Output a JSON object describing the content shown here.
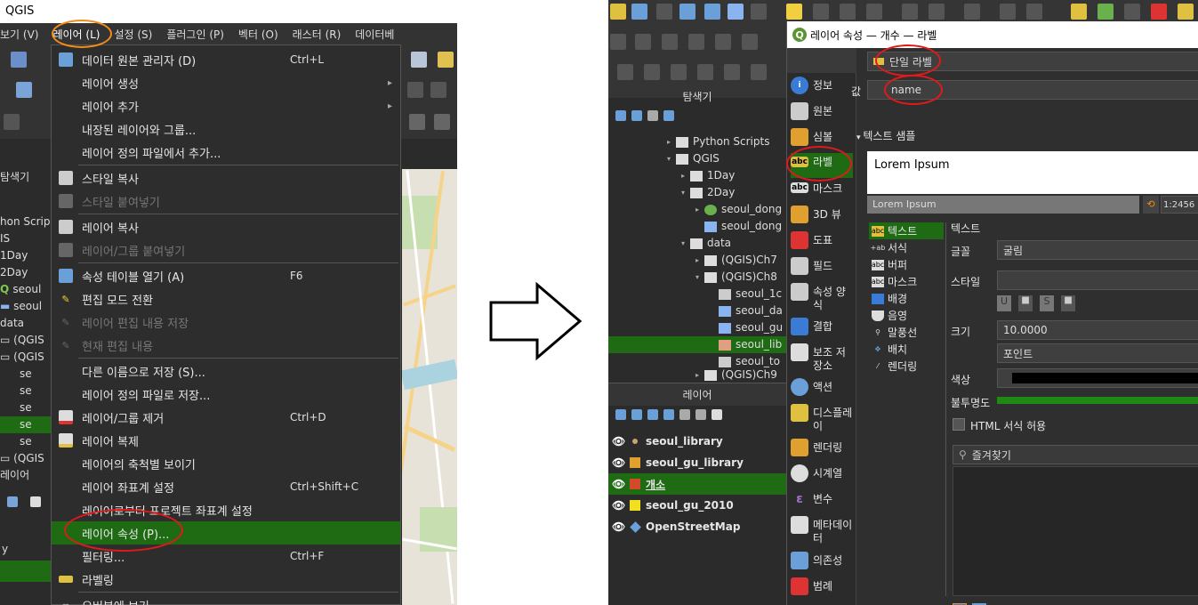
{
  "left": {
    "app_title": "QGIS",
    "menubar": [
      "보기 (V)",
      "레이어 (L)",
      "설정 (S)",
      "플러그인 (P)",
      "벡터 (O)",
      "래스터 (R)",
      "데이터베"
    ],
    "browser_label": "탐색기",
    "tree_items": [
      "hon Scrip",
      "IS",
      "1Day",
      "2Day",
      "seoul",
      "seoul",
      "data",
      "(QGIS",
      "(QGIS",
      "se",
      "se",
      "se",
      "se",
      "se",
      "(QGIS",
      "레이어"
    ],
    "bottom_label": "y",
    "menu": {
      "items": [
        {
          "label": "데이터 원본 관리자 (D)",
          "shortcut": "Ctrl+L",
          "arrow": ""
        },
        {
          "label": "레이어 생성",
          "shortcut": "",
          "arrow": "▸"
        },
        {
          "label": "레이어 추가",
          "shortcut": "",
          "arrow": "▸"
        },
        {
          "label": "내장된 레이어와 그룹...",
          "shortcut": "",
          "arrow": ""
        },
        {
          "label": "레이어 정의 파일에서 추가...",
          "shortcut": "",
          "arrow": ""
        },
        {
          "label": "스타일 복사",
          "shortcut": "",
          "arrow": ""
        },
        {
          "label": "스타일 붙여넣기",
          "shortcut": "",
          "arrow": ""
        },
        {
          "label": "레이어 복사",
          "shortcut": "",
          "arrow": ""
        },
        {
          "label": "레이어/그룹 붙여넣기",
          "shortcut": "",
          "arrow": ""
        },
        {
          "label": "속성 테이블 열기 (A)",
          "shortcut": "F6",
          "arrow": ""
        },
        {
          "label": "편집 모드 전환",
          "shortcut": "",
          "arrow": ""
        },
        {
          "label": "레이어 편집 내용 저장",
          "shortcut": "",
          "arrow": ""
        },
        {
          "label": "현재 편집 내용",
          "shortcut": "",
          "arrow": ""
        },
        {
          "label": "다른 이름으로 저장 (S)...",
          "shortcut": "",
          "arrow": ""
        },
        {
          "label": "레이어 정의 파일로 저장...",
          "shortcut": "",
          "arrow": ""
        },
        {
          "label": "레이어/그룹 제거",
          "shortcut": "Ctrl+D",
          "arrow": ""
        },
        {
          "label": "레이어 복제",
          "shortcut": "",
          "arrow": ""
        },
        {
          "label": "레이어의 축척별 보이기",
          "shortcut": "",
          "arrow": ""
        },
        {
          "label": "레이어 좌표계 설정",
          "shortcut": "Ctrl+Shift+C",
          "arrow": ""
        },
        {
          "label": "레이어로부터 프로젝트 좌표계 설정",
          "shortcut": "",
          "arrow": ""
        },
        {
          "label": "레이어 속성 (P)...",
          "shortcut": "",
          "arrow": ""
        },
        {
          "label": "필터링...",
          "shortcut": "Ctrl+F",
          "arrow": ""
        },
        {
          "label": "라벨링",
          "shortcut": "",
          "arrow": ""
        },
        {
          "label": "오버뷰에 보기",
          "shortcut": "",
          "arrow": ""
        }
      ]
    }
  },
  "right": {
    "browser_title": "탐색기",
    "tree": [
      {
        "label": "Python Scripts"
      },
      {
        "label": "QGIS"
      },
      {
        "label": "1Day"
      },
      {
        "label": "2Day"
      },
      {
        "label": "seoul_dong"
      },
      {
        "label": "seoul_dong"
      },
      {
        "label": "data"
      },
      {
        "label": "(QGIS)Ch7"
      },
      {
        "label": "(QGIS)Ch8"
      },
      {
        "label": "seoul_1c"
      },
      {
        "label": "seoul_da"
      },
      {
        "label": "seoul_gu"
      },
      {
        "label": "seoul_lib"
      },
      {
        "label": "seoul_to"
      },
      {
        "label": "(QGIS)Ch9"
      }
    ],
    "layers_title": "레이어",
    "layers": [
      {
        "label": "seoul_library",
        "color": "#c8a46e"
      },
      {
        "label": "seoul_gu_library",
        "color": "#e0a030"
      },
      {
        "label": "개소",
        "color": "#d24a2a"
      },
      {
        "label": "seoul_gu_2010",
        "color": "#f0e020"
      },
      {
        "label": "OpenStreetMap",
        "color": "#6a9fd8"
      }
    ],
    "dialog": {
      "title": "레이어 속성 — 개수 — 라벨",
      "sidebar": [
        "정보",
        "원본",
        "심볼",
        "라벨",
        "마스크",
        "3D 뷰",
        "도표",
        "필드",
        "속성 양식",
        "결합",
        "보조 저장소",
        "액션",
        "디스플레이",
        "렌더링",
        "시계열",
        "변수",
        "메타데이터",
        "의존성",
        "범례"
      ],
      "mode_combo": "단일 라벨",
      "value_label": "값",
      "value_combo": "name",
      "section_title": "텍스트 샘플",
      "sample_text": "Lorem Ipsum",
      "sample_bar_text": "Lorem Ipsum",
      "scale_text": "1:2456",
      "subtabs": [
        "텍스트",
        "서식",
        "버퍼",
        "마스크",
        "배경",
        "음영",
        "말풍선",
        "배치",
        "렌더링"
      ],
      "props": {
        "section": "텍스트",
        "font_label": "글꼴",
        "font_value": "굴림",
        "style_label": "스타일",
        "size_label": "크기",
        "size_value": "10.0000",
        "unit_value": "포인트",
        "color_label": "색상",
        "opacity_label": "불투명도",
        "html_label": "HTML 서식 허용",
        "search_placeholder": "즐겨찾기"
      }
    }
  },
  "colors": {
    "highlight": "#1e6b14",
    "annotation_red": "#e01a1a",
    "annotation_orange": "#f28c1a"
  }
}
